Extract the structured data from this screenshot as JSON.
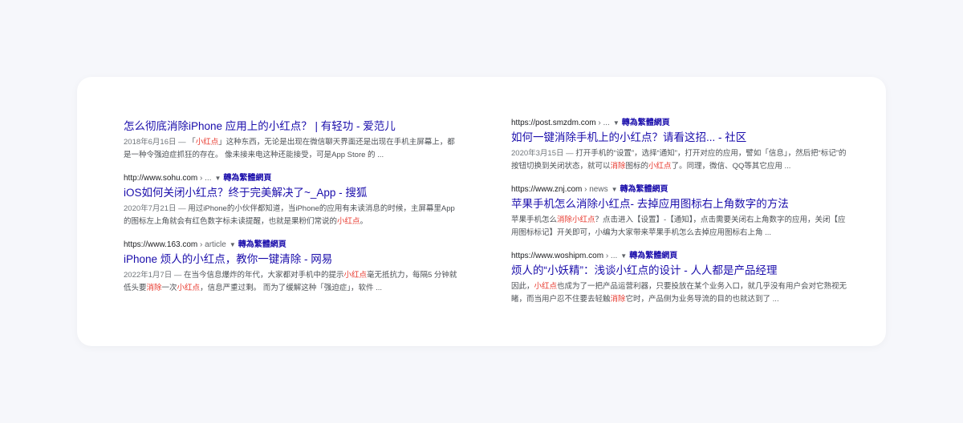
{
  "results_left": [
    {
      "url": null,
      "url_path": null,
      "title": "怎么彻底消除iPhone 应用上的小红点？ | 有轻功 - 爱范儿",
      "date": "2018年6月16日 —",
      "snippet": [
        {
          "t": " 「",
          "h": false
        },
        {
          "t": "小红点",
          "h": true
        },
        {
          "t": "」这种东西，无论是出现在微信聊天界面还是出现在手机主屏幕上，都是一种令强迫症抓狂的存在。 像未接来电这种还能接受，可是App Store 的 ...",
          "h": false
        }
      ]
    },
    {
      "url": "http://www.sohu.com",
      "url_path": " › ...",
      "translate": "轉為繁體網頁",
      "title": "iOS如何关闭小红点？终于完美解决了~_App - 搜狐",
      "date": "2020年7月21日 —",
      "snippet": [
        {
          "t": " 用过iPhone的小伙伴都知道，当iPhone的应用有未读消息的时候，主屏幕里App的图标左上角就会有红色数字标未读提醒，也就是果粉们常说的",
          "h": false
        },
        {
          "t": "小红点",
          "h": true
        },
        {
          "t": "。",
          "h": false
        }
      ]
    },
    {
      "url": "https://www.163.com",
      "url_path": " › article",
      "translate": "轉為繁體網頁",
      "title": "iPhone 烦人的小红点，教你一键清除 - 网易",
      "date": "2022年1月7日 —",
      "snippet": [
        {
          "t": " 在当今信息爆炸的年代，大家都对手机中的提示",
          "h": false
        },
        {
          "t": "小红点",
          "h": true
        },
        {
          "t": "毫无抵抗力，每隔5 分钟就低头要",
          "h": false
        },
        {
          "t": "消除",
          "h": true
        },
        {
          "t": "一次",
          "h": false
        },
        {
          "t": "小红点",
          "h": true
        },
        {
          "t": "，信息严重过剩。 而为了缓解这种「强迫症」，软件 ...",
          "h": false
        }
      ]
    }
  ],
  "results_right": [
    {
      "url": "https://post.smzdm.com",
      "url_path": " › ...",
      "translate": "轉為繁體網頁",
      "title": "如何一键消除手机上的小红点？请看这招... - 社区",
      "date": "2020年3月15日 —",
      "snippet": [
        {
          "t": " 打开手机的“设置”，选择“通知”，打开对应的应用，譬如「信息」，然后把“标记”的按钮切换到关闭状态，就可以",
          "h": false
        },
        {
          "t": "消除",
          "h": true
        },
        {
          "t": "图标的",
          "h": false
        },
        {
          "t": "小红点",
          "h": true
        },
        {
          "t": "了。同理，微信、QQ等其它应用 ...",
          "h": false
        }
      ]
    },
    {
      "url": "https://www.znj.com",
      "url_path": " › news",
      "translate": "轉為繁體網頁",
      "title": "苹果手机怎么消除小红点- 去掉应用图标右上角数字的方法",
      "date": "",
      "snippet": [
        {
          "t": "苹果手机怎么",
          "h": false
        },
        {
          "t": "消除小红点",
          "h": true
        },
        {
          "t": "？点击进入【设置】-【通知】，点击需要关闭右上角数字的应用，关闭【应用图标标记】开关即可，小编为大家带来苹果手机怎么去掉应用图标右上角 ...",
          "h": false
        }
      ]
    },
    {
      "url": "https://www.woshipm.com",
      "url_path": " › ...",
      "translate": "轉為繁體網頁",
      "title": "烦人的“小妖精”：浅谈小红点的设计 - 人人都是产品经理",
      "date": "",
      "snippet": [
        {
          "t": "因此，",
          "h": false
        },
        {
          "t": "小红点",
          "h": true
        },
        {
          "t": "也成为了一把产品运营利器，只要投放在某个业务入口，就几乎没有用户会对它熟视无睹，而当用户忍不住要去轻触",
          "h": false
        },
        {
          "t": "消除",
          "h": true
        },
        {
          "t": "它时，产品侧为业务导流的目的也就达到了 ...",
          "h": false
        }
      ]
    }
  ]
}
